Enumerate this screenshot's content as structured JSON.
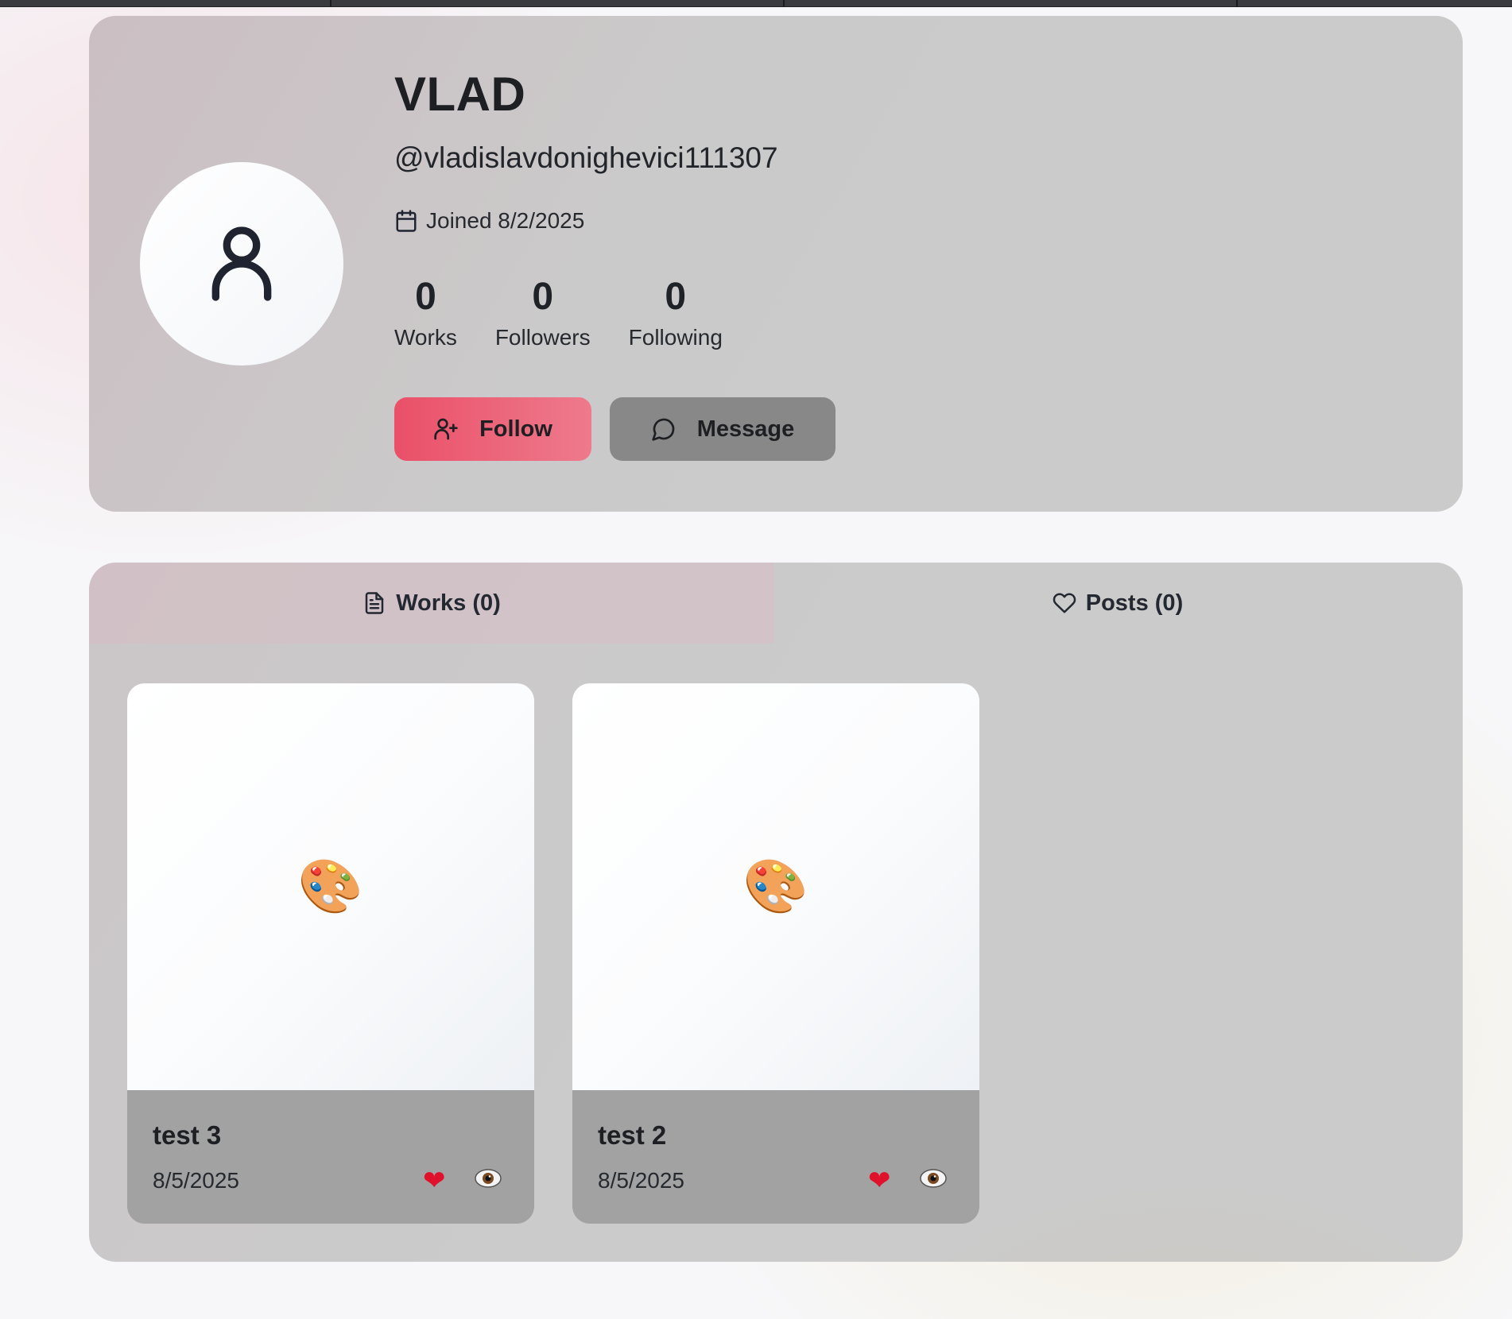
{
  "profile": {
    "display_name": "VLAD",
    "handle": "@vladislavdonighevici111307",
    "joined": "Joined 8/2/2025",
    "stats": [
      {
        "value": "0",
        "label": "Works"
      },
      {
        "value": "0",
        "label": "Followers"
      },
      {
        "value": "0",
        "label": "Following"
      }
    ],
    "actions": {
      "follow_label": "Follow",
      "message_label": "Message"
    }
  },
  "tabs": [
    {
      "label": "Works (0)",
      "icon": "document-icon",
      "active": true
    },
    {
      "label": "Posts (0)",
      "icon": "heart-outline-icon",
      "active": false
    }
  ],
  "works": [
    {
      "title": "test 3",
      "date": "8/5/2025",
      "thumb_icon": "🎨",
      "like_icon": "❤"
    },
    {
      "title": "test 2",
      "date": "8/5/2025",
      "thumb_icon": "🎨",
      "like_icon": "❤"
    }
  ],
  "colors": {
    "follow_start": "#ea5068",
    "follow_end": "#ee7a8c",
    "message_bg": "#888888",
    "card_bg": "#cbcbcb"
  }
}
